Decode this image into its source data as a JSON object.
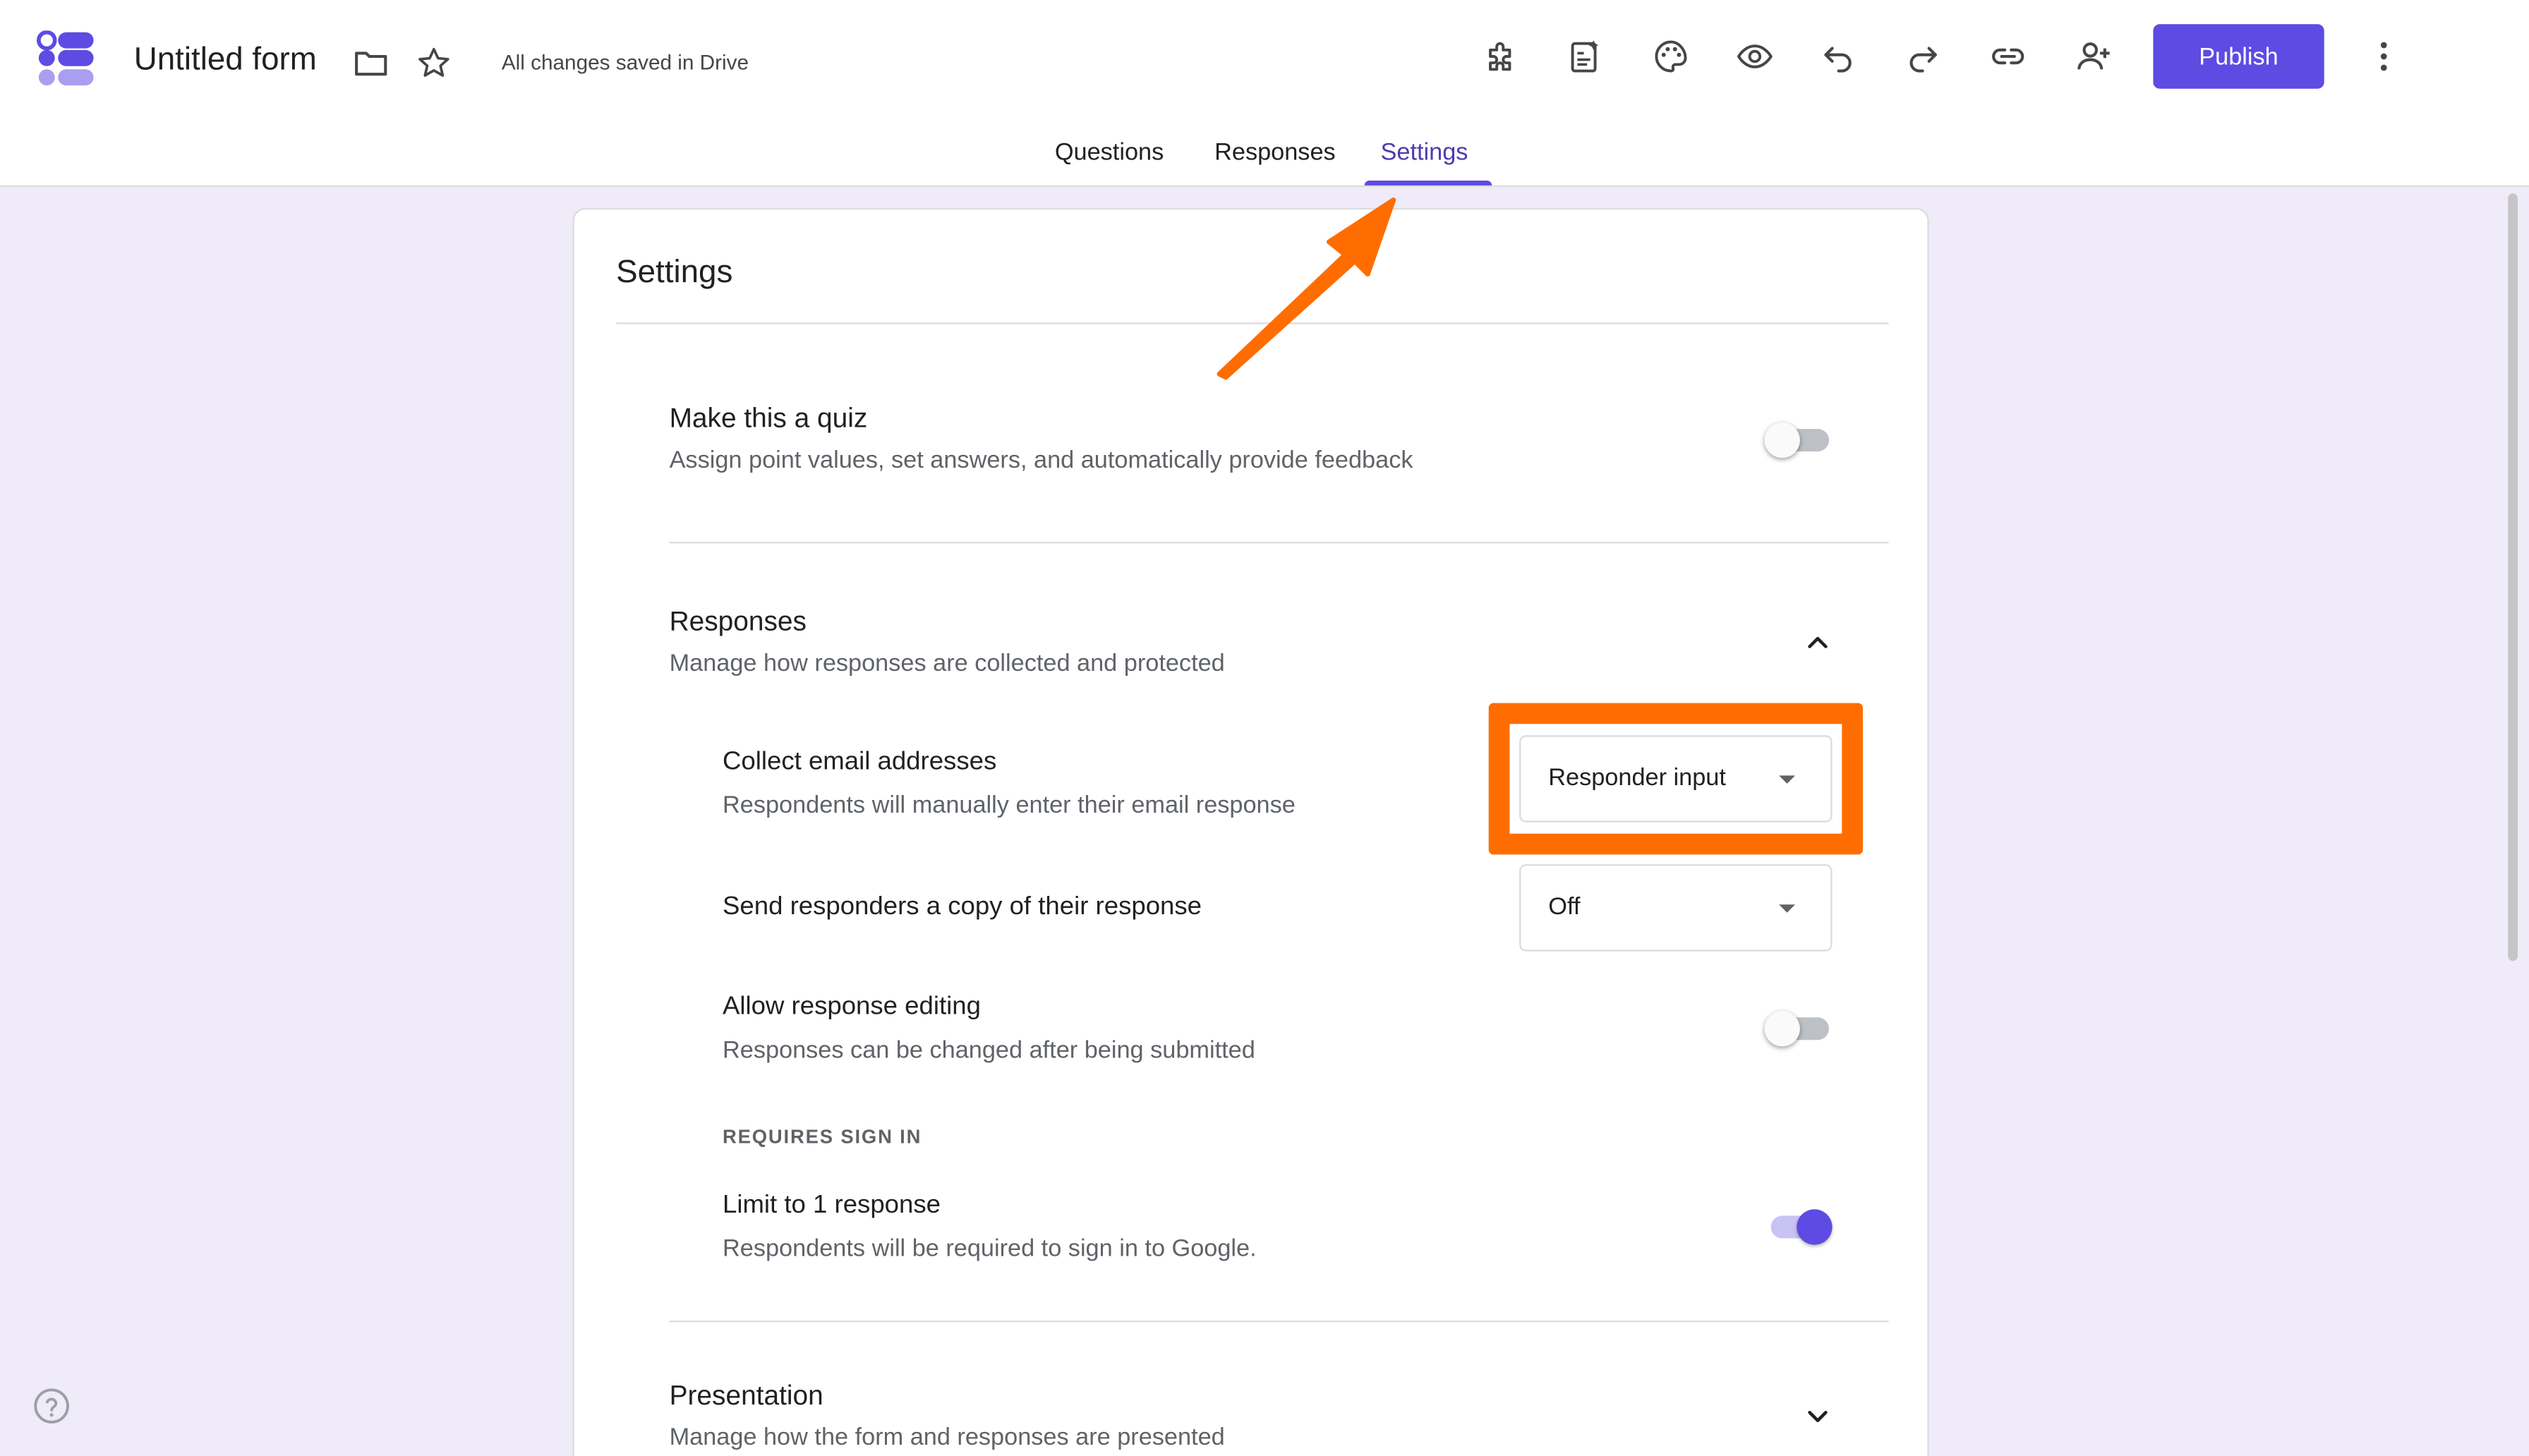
{
  "header": {
    "title": "Untitled form",
    "saved_status": "All changes saved in Drive",
    "publish_label": "Publish",
    "icons": [
      "folder-icon",
      "star-icon",
      "addon-icon",
      "ai-form-icon",
      "palette-icon",
      "preview-icon",
      "undo-icon",
      "redo-icon",
      "link-icon",
      "add-collaborator-icon",
      "more-vert-icon"
    ]
  },
  "tabs": [
    {
      "label": "Questions",
      "active": false
    },
    {
      "label": "Responses",
      "active": false
    },
    {
      "label": "Settings",
      "active": true
    }
  ],
  "settings": {
    "card_title": "Settings",
    "quiz": {
      "label": "Make this a quiz",
      "description": "Assign point values, set answers, and automatically provide feedback",
      "enabled": false
    },
    "responses": {
      "label": "Responses",
      "description": "Manage how responses are collected and protected",
      "expanded": true,
      "collect_email": {
        "label": "Collect email addresses",
        "description": "Respondents will manually enter their email response",
        "value": "Responder input"
      },
      "send_copy": {
        "label": "Send responders a copy of their response",
        "value": "Off"
      },
      "allow_editing": {
        "label": "Allow response editing",
        "description": "Responses can be changed after being submitted",
        "enabled": false
      },
      "requires_sign_in_caption": "REQUIRES SIGN IN",
      "limit_one": {
        "label": "Limit to 1 response",
        "description": "Respondents will be required to sign in to Google.",
        "enabled": true
      }
    },
    "presentation": {
      "label": "Presentation",
      "description": "Manage how the form and responses are presented",
      "expanded": false
    }
  },
  "colors": {
    "accent": "#5e4be3",
    "annotation": "#ff6d00",
    "background": "#f0ebf8"
  }
}
